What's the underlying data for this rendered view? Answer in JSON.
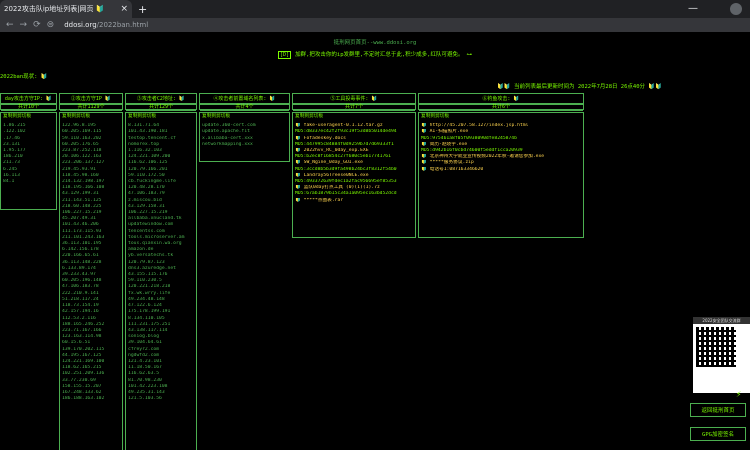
{
  "browser": {
    "tab_title": "2022攻击队ip地址列表|网页 🔰",
    "tab_close": "×",
    "new_tab": "+",
    "minimize": "—",
    "url_prefix": "ddosi.org",
    "url_path": "/2022ban.html"
  },
  "page": {
    "top_title": "挺刑网页首页--www.ddosi.org",
    "notice_box": "[D]",
    "notice": "加群,把攻击你的ip发群里,不定时汇总于此,积少成多,红队可避免。",
    "key_icon": "⊶",
    "download_label": "2022ban现状: 🔰",
    "update_time": "🔰🔰 当前列表最后更新时间为 2022年7月28日 26点40分 🔰🔰"
  },
  "columns": [
    {
      "header": "day攻击方守IP: 🔰",
      "count": "共计10个",
      "copy": "复制到剪切板",
      "items": [
        "1.86.215",
        ".122.102",
        ".17.46",
        "23.131",
        "1.95.177",
        "186.210",
        "211.73",
        "6.245",
        "16.113",
        "84.1"
      ]
    },
    {
      "header": "②攻击方守IP 🔰",
      "count": "共计1129个",
      "copy": "复制到剪切板",
      "items": [
        "122.96.8.195",
        "60.205.169.115",
        "59.110.163.202",
        "60.205.176.65",
        "223.87.252.118",
        "20.106.122.163",
        "223.206.137.127",
        "219.45.93.91",
        "118.45.98.160",
        "214.132.198.197",
        "118.195.166.108",
        "43.129.199.31",
        "211.143.51.125",
        "218.60.148.225",
        "106.227.15.219",
        "45.207.49.31",
        "101.43.46.206",
        "111.173.115.93",
        "211.101.243.163",
        "36.113.101.195",
        "6.142.156.178",
        "220.166.65.61",
        "36.113.148.228",
        "6.133.89.174",
        "39.233.43.97",
        "60.205.196.148",
        "47.106.183.78",
        "222.210.9.141",
        "51.218.117.24",
        "118.73.154.19",
        "42.157.194.16",
        "112.53.2.116",
        "188.165.246.252",
        "223.71.167.166",
        "123.163.114.98",
        "60.15.6.51",
        "139.170.202.115",
        "44.195.167.125",
        "124.221.169.100",
        "118.62.165.215",
        "102.251.209.136",
        "33.77.230.69",
        "158.155.15.207",
        "167.248.133.62",
        "186.188.163.102"
      ]
    },
    {
      "header": "③攻击者C2地址: 🔰",
      "count": "共计129个",
      "copy": "复制到剪切板",
      "items": [
        "8.131.71.64",
        "101.43.190.181",
        "testop.tencent.cf",
        "nomorex.top",
        "1.116.32.103",
        "124.221.109.200",
        "116.62.106.125",
        "120.79.166.201",
        "59.110.172.50",
        "cb.fuckingme.life",
        "120.48.28.170",
        "47.106.183.79",
        "z.miscou.bid",
        "43.129.158.31",
        "106.227.15.219",
        "allbaba.xnucland.tk",
        "updatewindow.com",
        "tencentss.com",
        "tools.microserver.am",
        "tous.qianxin.wa.org",
        "amazon.de",
        "yb.versatechs.tk",
        "120.79.87.123",
        "dns3.azuredge.net",
        "43.155.115.176",
        "59.110.230.5",
        "120.221.218.218",
        "fx.wk.wrry.life",
        "49.234.48.148",
        "47.122.6.124",
        "175.178.199.191",
        "8.134.110.105",
        "111.231.175.251",
        "43.138.117.114",
        "soniog.blog",
        "39.104.64.61",
        "cfreyr2.com",
        "ngdwfd2.com",
        "121.4.23.101",
        "11.18.50.167",
        "116.62.63.5",
        "81.70.98.230",
        "101.42.223.108",
        "49.235.31.143",
        "121.5.103.56"
      ]
    },
    {
      "header": "④攻击者前置域名列表: 🔰",
      "count": "共计4个",
      "copy": "复制到剪切板",
      "items": [
        "update.360-cert.com",
        "update.apache.fit",
        "x.alibaba-cert.xxx",
        "networkmapping.xxx"
      ]
    },
    {
      "header": "⑤工具投毒事件: 🔰",
      "count": "共计7个",
      "copy": "复制到剪切板",
      "items": [
        "🔰 fake-useragent-0.1.12.tar.gz",
        "MD5:d8337ec42f2f93c19f53d8b5014de494",
        "🔰 Fofadeskey.docs",
        "MD5:447995c84884f0d9259b7d7d69333f1",
        "🔰 2022hvv_RC_0day_exp.EXE",
        "MD5:b2ec8f16854c27f680c5eb17741761",
        "🔰 SW_Ngine_0day_GUI.exe",
        "MD5:3ccd8b5b3d9fa498b24bc3f8312f54b0",
        "🔰 Landray56Treese0NCE.exe",
        "MD5:493372639fdec1a2fac956695ef85353",
        "🔰 蓝队0day打点工具 (0)(1)(1).7z",
        "MD5:67ab1879b15c34a1a095ec163bd52dcd",
        "🔰 *****点图表.rar"
      ]
    },
    {
      "header": "⑥钓鱼攻击: 🔰",
      "count": "共计6个",
      "copy": "复制到剪切板",
      "items": [
        "🔰 http://45.207.58.127/index.jsp.html",
        "🔰 AI-扫描照片.exe",
        "MD5:975461a8f05f0938090dfe8245874b",
        "🔰 简历-赵晓宇.exe",
        "MD5:d942b16f0cbd74600f5eddf1cca20939",
        "🔰 北京神州大学就业宣传视频2022年秋-邀请您参加.exe",
        "🔰 *****服务协议.zip",
        "🔰 电话号1:087163346620"
      ]
    }
  ],
  "sidebar": {
    "qr_caption": "2022安全团队交流群",
    "btn_home": "返回挺刑首页",
    "btn_gpg": "GPG加密签名"
  },
  "watermark": "⚡"
}
